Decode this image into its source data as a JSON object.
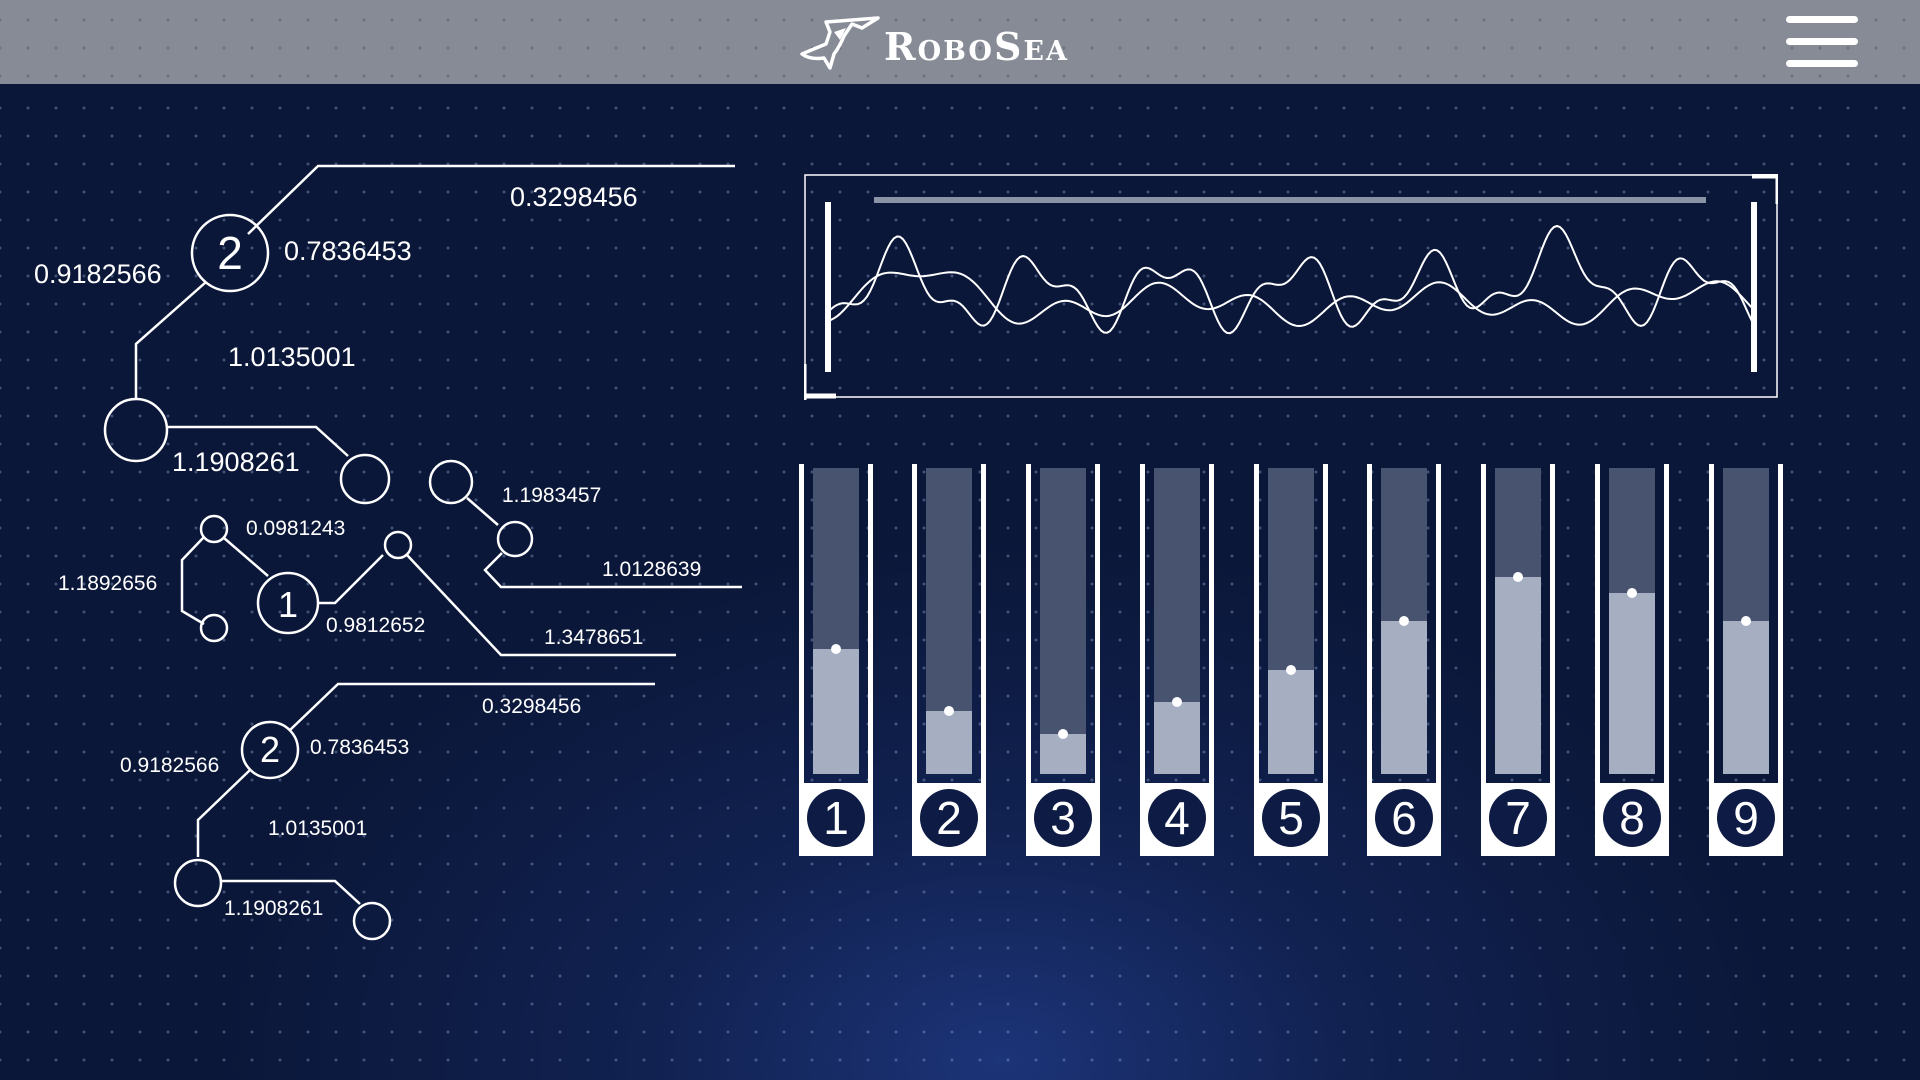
{
  "app": {
    "brand": "RoboSea"
  },
  "header": {
    "menu_icon": "hamburger-menu-icon"
  },
  "tree_top": {
    "node_main": "2",
    "labels": [
      "0.3298456",
      "0.7836453",
      "0.9182566",
      "1.0135001",
      "1.1908261"
    ]
  },
  "tree_mid": {
    "node_main": "1",
    "labels": [
      "1.1983457",
      "0.0981243",
      "1.1892656",
      "1.0128639",
      "0.9812652",
      "1.3478651"
    ]
  },
  "tree_bottom": {
    "node_main": "2",
    "labels": [
      "0.3298456",
      "0.7836453",
      "0.9182566",
      "1.0135001",
      "1.1908261"
    ]
  },
  "waveform": {
    "line_color": "#ffffff",
    "panel_border": "#ffffff"
  },
  "sliders": [
    {
      "label": "1",
      "level": 0.41
    },
    {
      "label": "2",
      "level": 0.205
    },
    {
      "label": "3",
      "level": 0.13
    },
    {
      "label": "4",
      "level": 0.235
    },
    {
      "label": "5",
      "level": 0.34
    },
    {
      "label": "6",
      "level": 0.5
    },
    {
      "label": "7",
      "level": 0.645
    },
    {
      "label": "8",
      "level": 0.59
    },
    {
      "label": "9",
      "level": 0.5
    }
  ]
}
